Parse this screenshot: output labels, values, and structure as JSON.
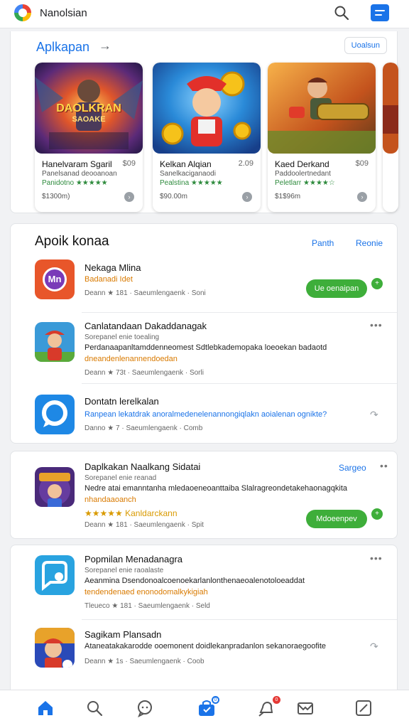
{
  "header": {
    "title": "Nanolsian"
  },
  "featured": {
    "title": "Aplkapan",
    "arrow": "→",
    "pill_button": "Uoalsun",
    "games": [
      {
        "art_text": "DAOLKRAN",
        "art_sub": "SAOAKE",
        "name": "Hanelvaram Sgaril",
        "price": "$09",
        "dev": "Panelsanad deooanoan",
        "rating": "Panidotno ★★★★★",
        "count": "$1300m)"
      },
      {
        "art_text": "",
        "art_sub": "",
        "name": "Kelkan Alqian",
        "price": "2.09",
        "dev": "Sanelkaciganaodi",
        "rating": "Pealstina ★★★★★",
        "count": "$90.00m"
      },
      {
        "art_text": "",
        "art_sub": "",
        "name": "Kaed Derkand",
        "price": "$09",
        "dev": "Paddoolertnedant",
        "rating": "Peletlarr ★★★★☆",
        "count": "$1$96m"
      }
    ]
  },
  "apps_section": {
    "title": "Apoik konaa",
    "link1": "Panth",
    "link2": "Reonie",
    "rows": [
      {
        "title": "Nekaga Mlina",
        "icon_text": "Mn",
        "sub": "Badanadi Idet",
        "meta": "Deann  ★ 181 · Saeumlengaenk · Soni",
        "button": "Ue oenaipan",
        "dot": "+"
      },
      {
        "title": "Canlatandaan Dakaddanagak",
        "sub": "Sorepanel enie toealing",
        "desc": "Perdanaapanltamddenneomest Sdtlebkademopaka loeoekan badaotd",
        "desc2": "dneandenlenannendoedan",
        "meta": "Deann  ★ 73t · Saeumlengaenk · Sorli",
        "more": "•••"
      },
      {
        "title": "Dontatn lerelkalan",
        "desc_mix": "Ranpean lekatdrak anoralmedenelenannongiqlakn aoialenan ognikte?",
        "meta": "Danno  ★ 7 · Saeumlengaenk · Comb",
        "share": "↷"
      }
    ]
  },
  "card3": {
    "rows": [
      {
        "title": "Daplkakan Naalkang Sidatai",
        "link": "Sargeo",
        "sub": "Sorepanel enie reanad",
        "desc": "Nedre atai emanntanha mledaoeneoanttaiba Slalragreondetakehaonagqkita",
        "desc2": "nhandaaoanch",
        "rating": "★★★★★  Kanldarckann",
        "meta": "Deann  ★ 181 · Saeumlengaenk · Spit",
        "button": "Mdoeenpev",
        "dot": "+"
      }
    ]
  },
  "card4": {
    "rows": [
      {
        "title": "Popmilan Menadanagra",
        "sub": "Sorepanel enie raoalaste",
        "desc": "Aeanmina Dsendonoalcoenoekarlanlonthenaeoalenotoloeaddat",
        "desc2": "tendendenaed enonodomalkykigiah",
        "meta": "Tleueco  ★ 181 · Saeumlengaenk · Seld",
        "more": "•••"
      },
      {
        "title": "Sagikam Plansadn",
        "desc": "Ataneatakakarodde ooemonent doidlekanpradanlon sekanoraegoofite",
        "meta": "Deann  ★ 1s · Saeumlengaenk · Coob",
        "share": "↷"
      }
    ]
  },
  "bottom_nav": {
    "badge_blue": "0",
    "badge_red": "0"
  }
}
